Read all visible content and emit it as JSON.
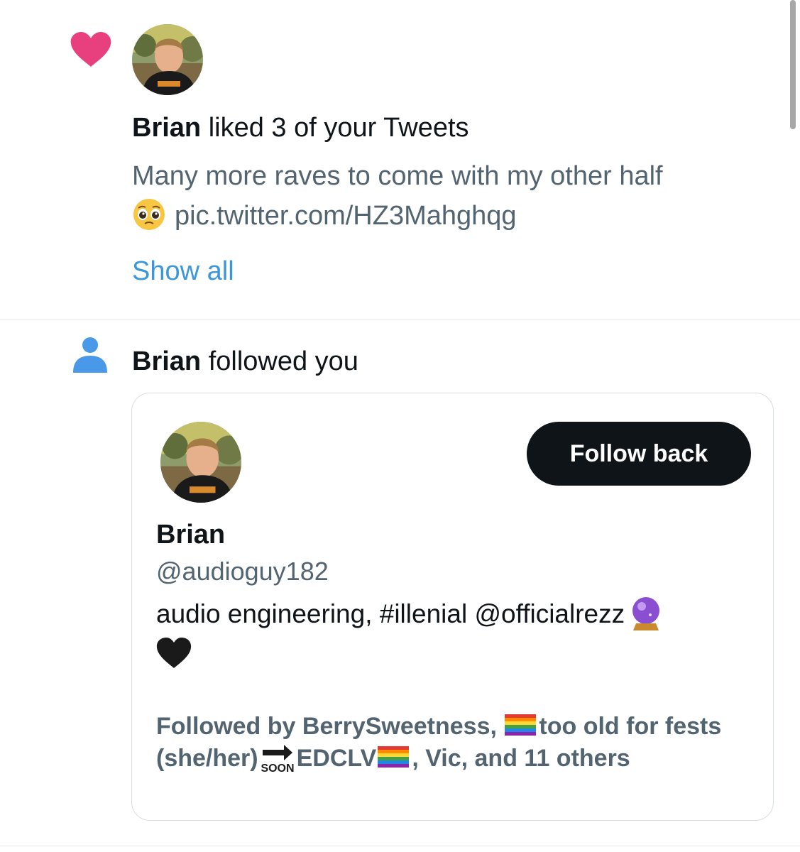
{
  "like_notification": {
    "actor_name": "Brian",
    "action_text": " liked 3 of your Tweets",
    "tweet_text": "Many more raves to come with my other half",
    "tweet_link": "pic.twitter.com/HZ3Mahghqg",
    "show_all_label": "Show all",
    "icon": "heart-icon",
    "icon_color": "#e8407f"
  },
  "follow_notification": {
    "actor_name": "Brian",
    "action_text": " followed you",
    "icon": "person-icon",
    "icon_color": "#4a99e9"
  },
  "user_card": {
    "name": "Brian",
    "handle": "@audioguy182",
    "bio_text": "audio engineering, #illenial @officialrezz",
    "follow_back_label": "Follow back",
    "followed_by_prefix": "Followed by BerrySweetness, ",
    "followed_by_part2": "too old for fests (she/her)",
    "followed_by_part3": "EDCLV",
    "followed_by_suffix": ", Vic, and 11 others",
    "soon_label": "SOON"
  },
  "colors": {
    "primary_text": "#0f1419",
    "secondary_text": "#536471",
    "link": "#3b97d8",
    "button_bg": "#0f1419"
  }
}
